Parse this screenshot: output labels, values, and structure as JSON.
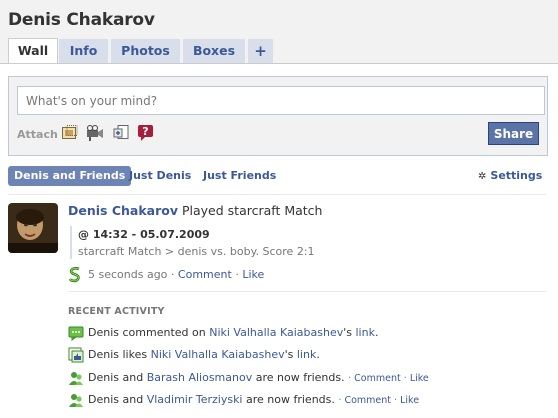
{
  "profile": {
    "name": "Denis Chakarov"
  },
  "tabs": [
    {
      "label": "Wall",
      "active": true
    },
    {
      "label": "Info"
    },
    {
      "label": "Photos"
    },
    {
      "label": "Boxes"
    },
    {
      "label": "+"
    }
  ],
  "publisher": {
    "placeholder": "What's on your mind?",
    "attach_label": "Attach",
    "attach_icons": [
      "photo-icon",
      "video-icon",
      "link-icon",
      "question-icon"
    ],
    "share_label": "Share"
  },
  "filters": {
    "items": [
      "Denis and Friends",
      "Just Denis",
      "Just Friends"
    ],
    "settings_label": "Settings"
  },
  "story": {
    "actor": "Denis Chakarov",
    "action": "Played starcraft Match",
    "quote_title": "@ 14:32 - 05.07.2009",
    "quote_body": "starcraft Match > denis vs. boby. Score 2:1",
    "time": "5 seconds ago",
    "dot": "·",
    "comment": "Comment",
    "like": "Like"
  },
  "recent": {
    "title": "RECENT ACTIVITY",
    "items": [
      {
        "actor": "Denis",
        "verb": "commented on",
        "target": "Niki Valhalla Kaiabashev",
        "suffix": "'s",
        "object": "link",
        "end": "."
      },
      {
        "actor": "Denis",
        "verb": "likes",
        "target": "Niki Valhalla Kaiabashev",
        "suffix": "'s",
        "object": "link",
        "end": "."
      },
      {
        "actor": "Denis",
        "verb": "and",
        "target": "Barash Aliosmanov",
        "suffix": "are now friends.",
        "comment": "Comment",
        "like": "Like"
      },
      {
        "actor": "Denis",
        "verb": "and",
        "target": "Vladimir Terziyski",
        "suffix": "are now friends.",
        "comment": "Comment",
        "like": "Like"
      }
    ]
  },
  "colors": {
    "link": "#3b5998",
    "tab_bg": "#d8dfea",
    "share_bg": "#5b74a8",
    "filter_active_bg": "#6d84b4",
    "header_bg": "#f2f2f2"
  }
}
